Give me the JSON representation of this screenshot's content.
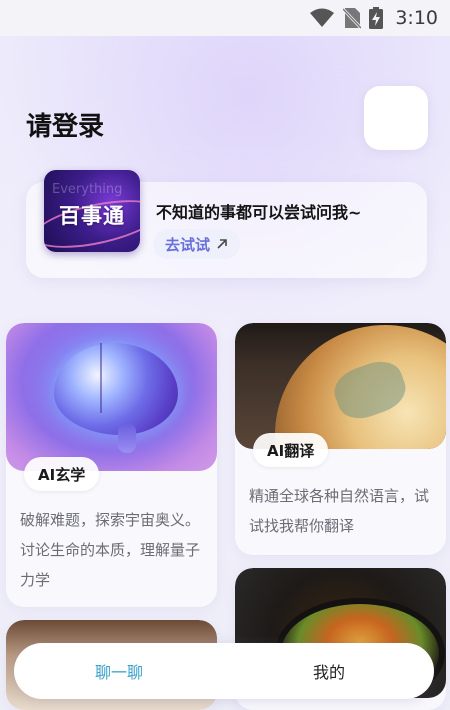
{
  "status_bar": {
    "time": "3:10",
    "icons": [
      "wifi-icon",
      "no-sim-icon",
      "battery-charging-icon"
    ]
  },
  "header": {
    "title": "请登录"
  },
  "promo": {
    "brand_text": "百事通",
    "brand_ghost_text": "Everything",
    "text": "不知道的事都可以尝试问我~",
    "try_label": "去试试",
    "try_icon": "arrow-up-right-icon"
  },
  "cards": [
    {
      "label": "AI玄学",
      "desc": "破解难题，探索宇宙奥义。讨论生命的本质，理解量子力学"
    },
    {
      "label": "AI翻译",
      "desc": "精通全球各种自然语言，试试找我帮你翻译"
    }
  ],
  "bottom_nav": {
    "tabs": [
      {
        "label": "聊一聊",
        "active": true
      },
      {
        "label": "我的",
        "active": false
      }
    ]
  },
  "colors": {
    "accent": "#3aa0c8",
    "try_button_text": "#6a6fd9"
  }
}
